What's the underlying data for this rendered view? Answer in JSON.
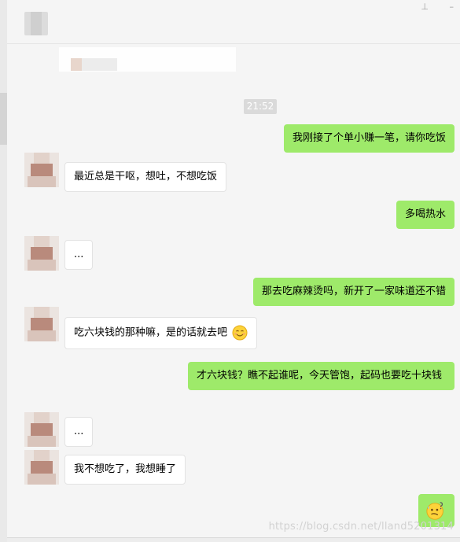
{
  "header": {
    "pin_icon": "pin-icon"
  },
  "chat": {
    "time": "21:52",
    "messages": [
      {
        "side": "out",
        "text": "我刚接了个单小赚一笔，请你吃饭"
      },
      {
        "side": "in",
        "text": "最近总是干呕，想吐，不想吃饭"
      },
      {
        "side": "out",
        "text": "多喝热水"
      },
      {
        "side": "in",
        "text": "..."
      },
      {
        "side": "out",
        "text": "那去吃麻辣烫吗，新开了一家味道还不错"
      },
      {
        "side": "in",
        "text": "吃六块钱的那种嘛，是的话就去吧",
        "emoji": "smile-emoji"
      },
      {
        "side": "out",
        "text": "才六块钱？瞧不起谁呢，今天管饱，起码也要吃十块钱"
      },
      {
        "side": "in",
        "text": "..."
      },
      {
        "side": "in",
        "text": "我不想吃了，我想睡了"
      },
      {
        "side": "out",
        "emoji": "confused-sweat-emoji"
      }
    ]
  },
  "watermark": "https://blog.csdn.net/lland5201314",
  "colors": {
    "outgoing_bubble": "#9eea6a",
    "incoming_bubble": "#ffffff",
    "background": "#f5f5f5"
  }
}
